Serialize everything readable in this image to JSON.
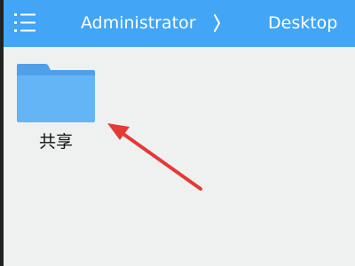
{
  "header": {
    "breadcrumb": [
      "Administrator",
      "Desktop"
    ],
    "menu_icon": "list-menu-icon",
    "separator_icon": "chevron-right-icon",
    "accent_color": "#42a5f5"
  },
  "files": [
    {
      "name": "共享",
      "icon": "folder-icon",
      "color": "#64b5f6"
    }
  ],
  "annotation": {
    "icon": "red-arrow",
    "color": "#e53935"
  }
}
